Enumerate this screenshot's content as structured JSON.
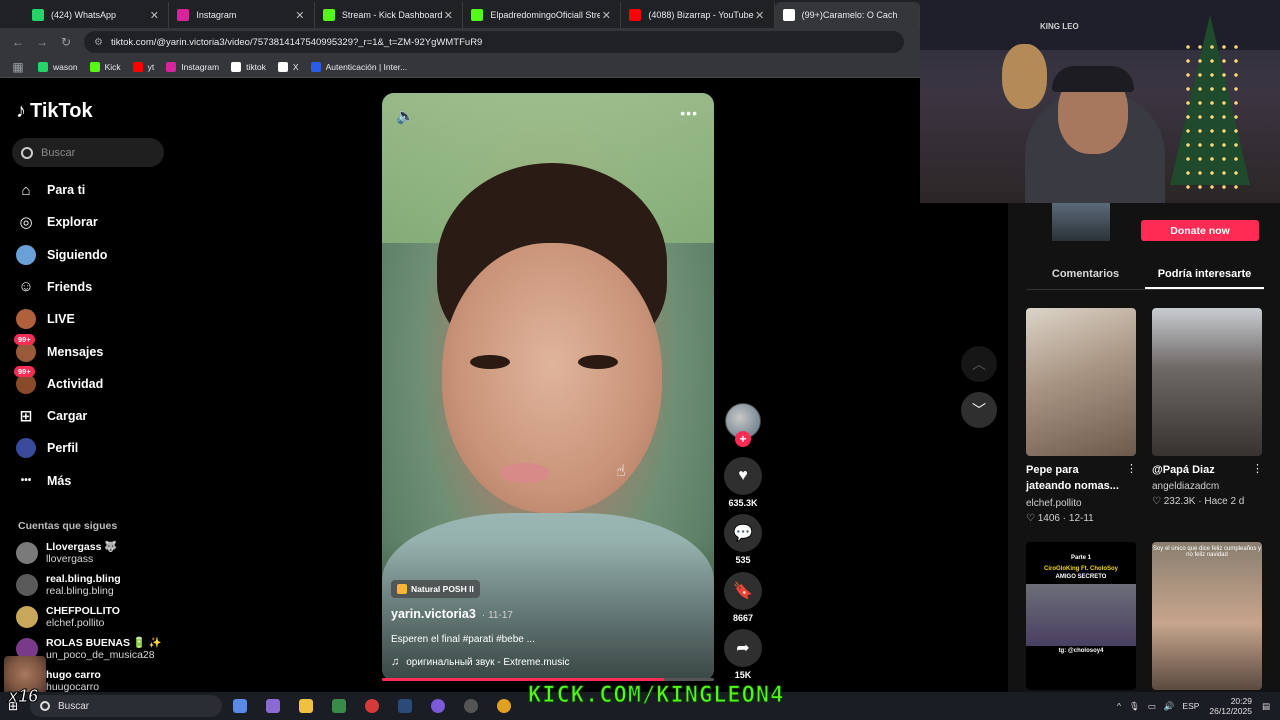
{
  "browser": {
    "tabs": [
      {
        "title": "(424) WhatsApp",
        "color": "#25d366",
        "active": false
      },
      {
        "title": "Instagram",
        "color": "#d6249f",
        "active": false
      },
      {
        "title": "Stream - Kick Dashboard",
        "color": "#53fc18",
        "active": false
      },
      {
        "title": "ElpadredomingoOficiall Stream",
        "color": "#53fc18",
        "active": false
      },
      {
        "title": "(4088) Bizarrap - YouTube",
        "color": "#ff0000",
        "active": false
      },
      {
        "title": "(99+)Caramelo: O Cach",
        "color": "#ffffff",
        "active": true
      }
    ],
    "url": "tiktok.com/@yarin.victoria3/video/7573814147540995329?_r=1&_t=ZM-92YgWMTFuR9",
    "bookmarks": [
      {
        "label": "wason",
        "color": "#25d366"
      },
      {
        "label": "Kick",
        "color": "#53fc18"
      },
      {
        "label": "yt",
        "color": "#ff0000"
      },
      {
        "label": "Instagram",
        "color": "#d6249f"
      },
      {
        "label": "tiktok",
        "color": "#ffffff"
      },
      {
        "label": "X",
        "color": "#ffffff"
      },
      {
        "label": "Autenticación | Inter...",
        "color": "#2b5ce6"
      }
    ]
  },
  "sidebar": {
    "logo": "TikTok",
    "search_placeholder": "Buscar",
    "nav": [
      {
        "label": "Para ti",
        "icon": "home-icon"
      },
      {
        "label": "Explorar",
        "icon": "compass-icon"
      },
      {
        "label": "Siguiendo",
        "icon": "following-icon"
      },
      {
        "label": "Friends",
        "icon": "friends-icon"
      },
      {
        "label": "LIVE",
        "icon": "live-icon"
      },
      {
        "label": "Mensajes",
        "icon": "messages-icon",
        "badge": "99+"
      },
      {
        "label": "Actividad",
        "icon": "activity-icon",
        "badge": "99+"
      },
      {
        "label": "Cargar",
        "icon": "upload-icon"
      },
      {
        "label": "Perfil",
        "icon": "profile-icon"
      },
      {
        "label": "Más",
        "icon": "more-icon"
      }
    ],
    "following_title": "Cuentas que sigues",
    "following": [
      {
        "name": "Llovergass 🐺",
        "user": "llovergass"
      },
      {
        "name": "real.bling.bling",
        "user": "real.bling.bling"
      },
      {
        "name": "CHEFPOLLITO",
        "user": "elchef.pollito"
      },
      {
        "name": "ROLAS BUENAS 🔋 ✨",
        "user": "un_poco_de_musica28"
      },
      {
        "name": "hugo carro",
        "user": "huugocarro"
      }
    ]
  },
  "video": {
    "effect": "Natural POSH II",
    "author": "yarin.victoria3",
    "date": "11-17",
    "description": "Esperen el final #parati #bebe ...",
    "sound": "оригинальный звук - Extreme.music",
    "progress": 0.85,
    "likes": "635.3K",
    "comments": "535",
    "saves": "8667",
    "shares": "15K"
  },
  "right_panel": {
    "donate_label": "Donate now",
    "tabs": [
      "Comentarios",
      "Podría interesarte"
    ],
    "active_tab": 1,
    "cards": [
      {
        "title": "Pepe para jateando nomas...",
        "author": "elchef.pollito",
        "likes": "1406",
        "date": "12-11"
      },
      {
        "title": "@Papá Diaz",
        "author": "angeldiazadcm",
        "likes": "232.3K",
        "date": "Hace 2 d"
      }
    ],
    "thumb3": {
      "line1": "Parte 1",
      "line2": "CiroGloKing Ft. CholoSoy",
      "line3": "AMIGO SECRETO",
      "line4": "tg: @cholosoy4"
    },
    "thumb4": {
      "line1": "Soy el único que dice feliz cumpleaños y no feliz navidad"
    }
  },
  "stream": {
    "kick_url": "KICK.COM/KINGLEON4",
    "multiplier": "x16",
    "cam_text": "KING LEO"
  },
  "taskbar": {
    "search_placeholder": "Buscar",
    "lang": "ESP",
    "time": "20:29",
    "date": "26/12/2025"
  }
}
